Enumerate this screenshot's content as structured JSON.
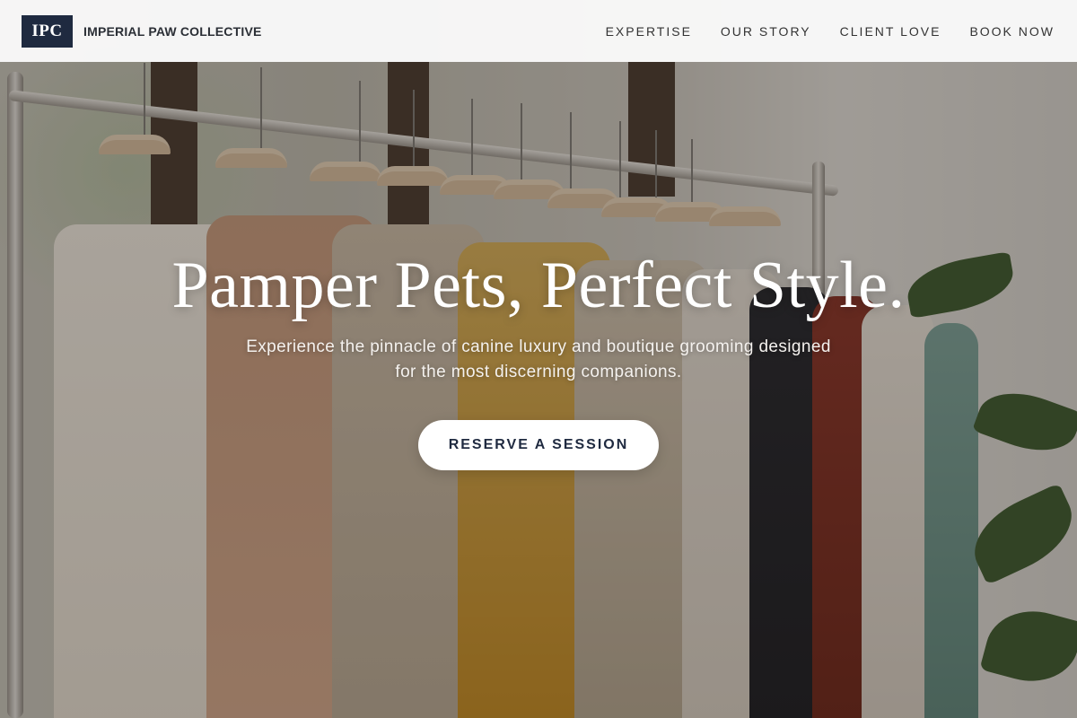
{
  "brand": {
    "logo_text": "IPC",
    "name": "IMPERIAL PAW COLLECTIVE"
  },
  "nav": {
    "links": [
      {
        "label": "EXPERTISE"
      },
      {
        "label": "OUR STORY"
      },
      {
        "label": "CLIENT LOVE"
      },
      {
        "label": "BOOK NOW"
      }
    ]
  },
  "hero": {
    "headline": "Pamper Pets, Perfect Style.",
    "subheadline": "Experience the pinnacle of canine luxury and boutique grooming designed for the most discerning companions.",
    "cta_label": "RESERVE A SESSION",
    "background_image": "clothing rack with hangers and shirts"
  },
  "colors": {
    "brand_navy": "#1f2a40",
    "nav_background": "#fafafa",
    "cta_background": "#ffffff",
    "headline_text": "#ffffff"
  }
}
